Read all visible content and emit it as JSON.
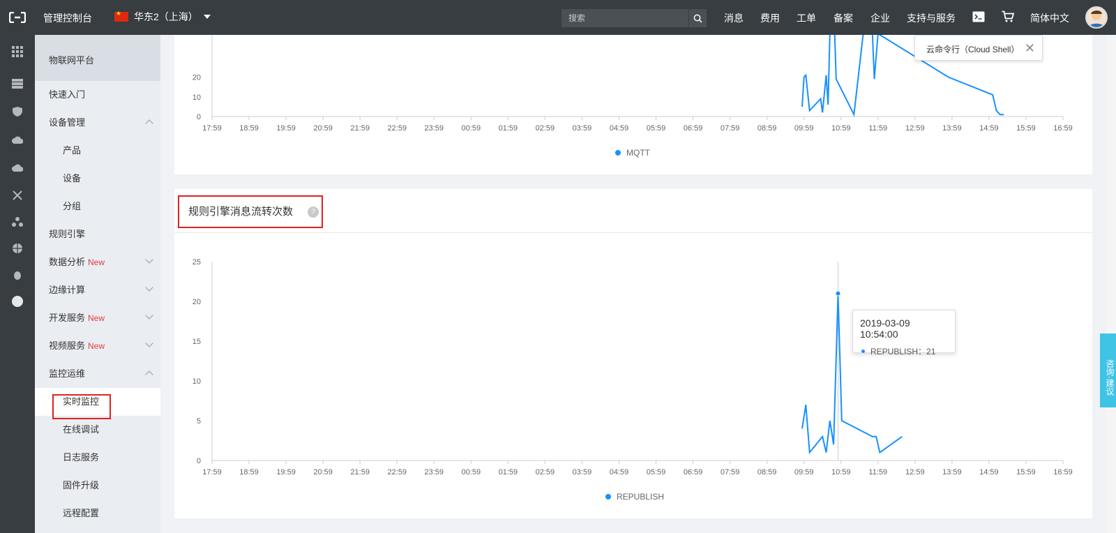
{
  "topbar": {
    "console_title": "管理控制台",
    "region": "华东2（上海）",
    "search_placeholder": "搜索",
    "nav": [
      "消息",
      "费用",
      "工单",
      "备案",
      "企业",
      "支持与服务",
      "简体中文"
    ]
  },
  "sidebar": {
    "header": "物联网平台",
    "items": [
      {
        "label": "快速入门"
      },
      {
        "label": "设备管理"
      },
      {
        "label": "产品"
      },
      {
        "label": "设备"
      },
      {
        "label": "分组"
      },
      {
        "label": "规则引擎"
      },
      {
        "label": "数据分析",
        "badge": "New"
      },
      {
        "label": "边缘计算"
      },
      {
        "label": "开发服务",
        "badge": "New"
      },
      {
        "label": "视频服务",
        "badge": "New"
      },
      {
        "label": "监控运维"
      },
      {
        "label": "实时监控"
      },
      {
        "label": "在线调试"
      },
      {
        "label": "日志服务"
      },
      {
        "label": "固件升级"
      },
      {
        "label": "远程配置"
      }
    ]
  },
  "shell_tooltip": "云命令行（Cloud Shell）",
  "section2_title": "规则引擎消息流转次数",
  "tooltip": {
    "time": "2019-03-09 10:54:00",
    "series_value": "REPUBLISH：21"
  },
  "consult_label": "咨询·建议",
  "colors": {
    "topbar": "#373d41",
    "series": "#1890ff",
    "highlight_box": "#e02020"
  },
  "chart_data": [
    {
      "type": "line",
      "x_ticks": [
        "17:59",
        "18:59",
        "19:59",
        "20:59",
        "21:59",
        "22:59",
        "23:59",
        "00:59",
        "01:59",
        "02:59",
        "03:59",
        "04:59",
        "05:59",
        "06:59",
        "07:59",
        "08:59",
        "09:59",
        "10:59",
        "11:59",
        "12:59",
        "13:59",
        "14:59",
        "15:59",
        "16:59"
      ],
      "y_ticks": [
        0,
        10,
        20
      ],
      "ylim": [
        0,
        40
      ],
      "series": [
        {
          "name": "MQTT",
          "points": [
            [
              15.95,
              5
            ],
            [
              16.0,
              20
            ],
            [
              16.05,
              21
            ],
            [
              16.15,
              3
            ],
            [
              16.45,
              9
            ],
            [
              16.5,
              2
            ],
            [
              16.6,
              21
            ],
            [
              16.65,
              6
            ],
            [
              16.7,
              42
            ],
            [
              16.83,
              42
            ],
            [
              16.87,
              19
            ],
            [
              17.35,
              1
            ],
            [
              17.6,
              42
            ],
            [
              17.85,
              42
            ],
            [
              17.9,
              19
            ],
            [
              18.0,
              42
            ],
            [
              19.9,
              20
            ],
            [
              21.1,
              11
            ],
            [
              21.2,
              3
            ],
            [
              21.3,
              1
            ],
            [
              21.4,
              1
            ]
          ]
        }
      ]
    },
    {
      "type": "line",
      "title": "规则引擎消息流转次数",
      "x_ticks": [
        "17:59",
        "18:59",
        "19:59",
        "20:59",
        "21:59",
        "22:59",
        "23:59",
        "00:59",
        "01:59",
        "02:59",
        "03:59",
        "04:59",
        "05:59",
        "06:59",
        "07:59",
        "08:59",
        "09:59",
        "10:59",
        "11:59",
        "12:59",
        "13:59",
        "14:59",
        "15:59",
        "16:59"
      ],
      "y_ticks": [
        0,
        5,
        10,
        15,
        20,
        25
      ],
      "ylim": [
        0,
        25
      ],
      "series": [
        {
          "name": "REPUBLISH",
          "points": [
            [
              15.95,
              4
            ],
            [
              16.05,
              7
            ],
            [
              16.15,
              1
            ],
            [
              16.5,
              3
            ],
            [
              16.6,
              1
            ],
            [
              16.7,
              5
            ],
            [
              16.8,
              2
            ],
            [
              16.92,
              21
            ],
            [
              17.02,
              5
            ],
            [
              17.85,
              3
            ],
            [
              17.95,
              3
            ],
            [
              18.05,
              1
            ],
            [
              18.65,
              3
            ]
          ]
        }
      ]
    }
  ]
}
